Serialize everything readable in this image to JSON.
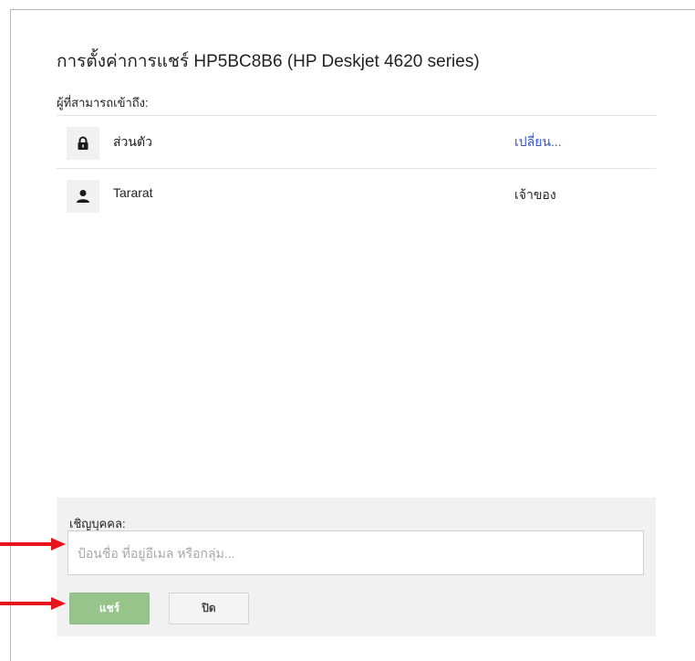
{
  "dialog": {
    "title": "การตั้งค่าการแชร์ HP5BC8B6 (HP Deskjet 4620 series)",
    "access_label": "ผู้ที่สามารถเข้าถึง:"
  },
  "access_list": [
    {
      "icon": "lock-icon",
      "name": "ส่วนตัว",
      "action": "เปลี่ยน..."
    },
    {
      "icon": "person-icon",
      "name": "Tararat",
      "action": "เจ้าของ"
    }
  ],
  "invite": {
    "label": "เชิญบุคคล:",
    "placeholder": "ป้อนชื่อ ที่อยู่อีเมล หรือกลุ่ม...",
    "value": ""
  },
  "buttons": {
    "share_label": "แชร์",
    "close_label": "ปิด"
  },
  "colors": {
    "link": "#3355cc",
    "share_button": "#96c48a",
    "annotation_arrow": "#e8141b",
    "panel_background": "#f1f1f1"
  }
}
